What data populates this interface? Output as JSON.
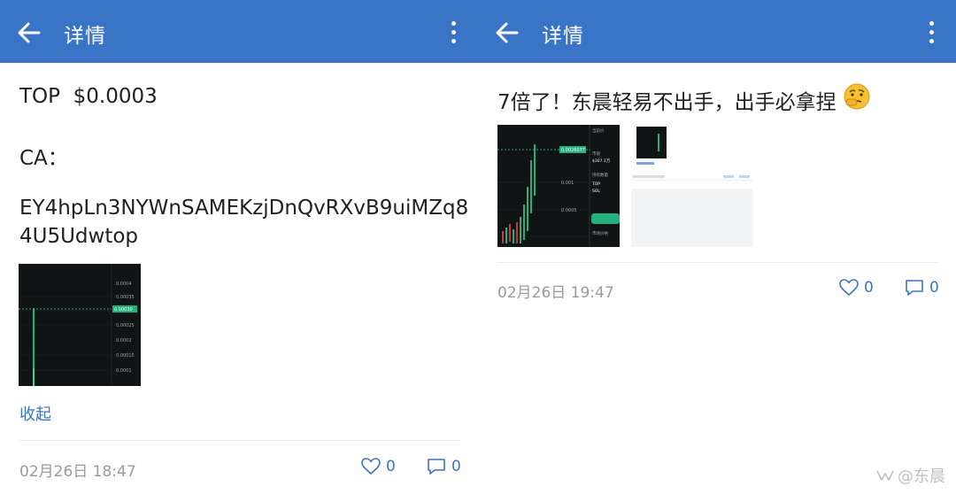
{
  "left": {
    "header": {
      "title": "详情"
    },
    "post": {
      "line1": "TOP  $0.0003",
      "line2": "CA：",
      "line3a": "EY4hpLn3NYWnSAMEKzjDnQvRXvB9uiMZq8",
      "line3b": "4U5Udwtop",
      "collapse": "收起",
      "timestamp": "02月26日 18:47",
      "likes": "0",
      "comments": "0"
    },
    "chart_image": {
      "price_labels": [
        "0.0004",
        "0.00035",
        "0.00030",
        "0.00025",
        "0.0002",
        "0.00015",
        "0.0001",
        "0.00005"
      ],
      "current_price": "0.00030"
    }
  },
  "right": {
    "header": {
      "title": "详情"
    },
    "post": {
      "text": "7倍了！东晨轻易不出手，出手必拿捏",
      "timestamp": "02月26日 19:47",
      "likes": "0",
      "comments": "0"
    },
    "chart_image": {
      "price_labels": [
        "0.001",
        "0.0005"
      ],
      "current_price": "0.0026077",
      "side_labels": [
        "当前价",
        "市值",
        "$307.1万",
        "持有数量",
        "TOP",
        "SOL",
        "市场价格"
      ]
    }
  },
  "watermark": "@东晨"
}
